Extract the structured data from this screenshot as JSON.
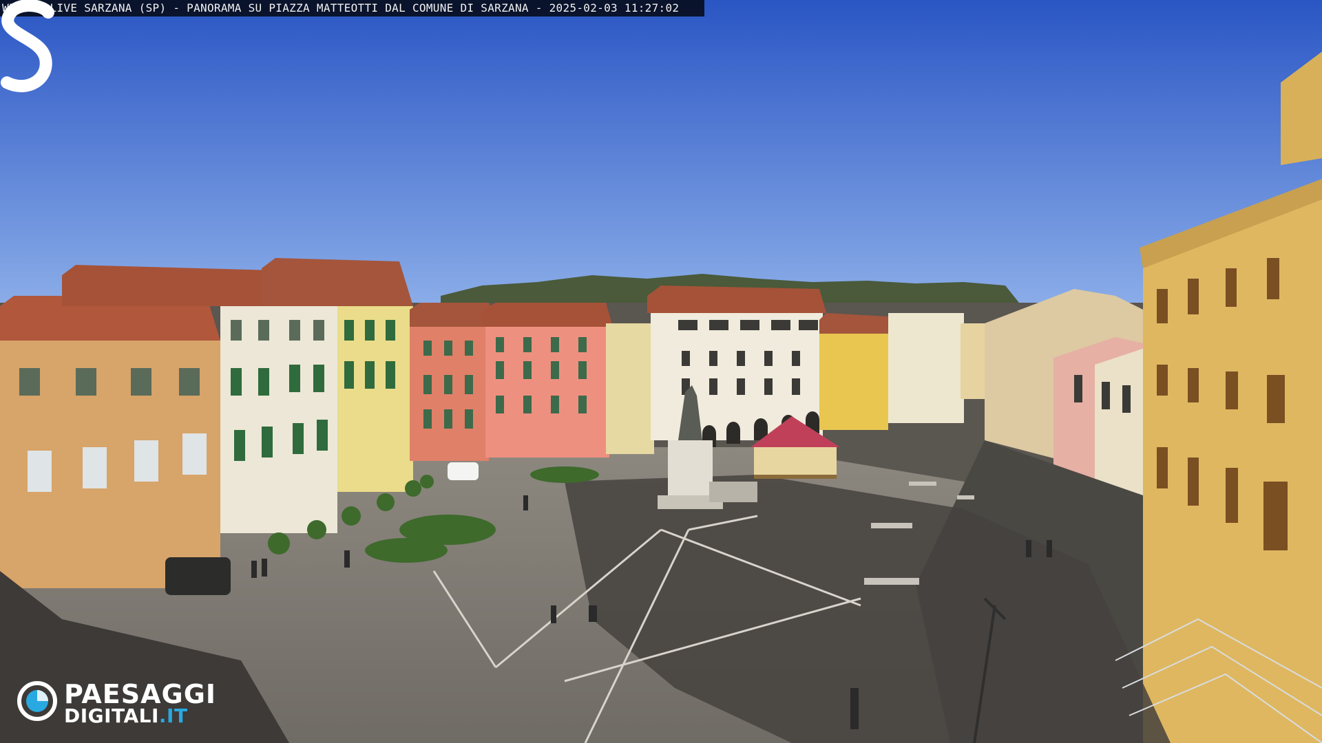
{
  "overlay": {
    "caption": "WEBCAM LIVE SARZANA (SP) - PANORAMA SU PIAZZA MATTEOTTI DAL COMUNE DI SARZANA - 2025-02-03  11:27:02"
  },
  "watermark": {
    "brand_line1": "PAESAGGI",
    "brand_line2_main": "DIGITALI",
    "brand_line2_tld": ".IT",
    "corner_mark": "S"
  },
  "colors": {
    "sky_top": "#2a56c4",
    "sky_bottom": "#86a8e6",
    "pavement": "#7a766f",
    "shadow": "#3e3c39",
    "brand_accent": "#29a9e1"
  }
}
